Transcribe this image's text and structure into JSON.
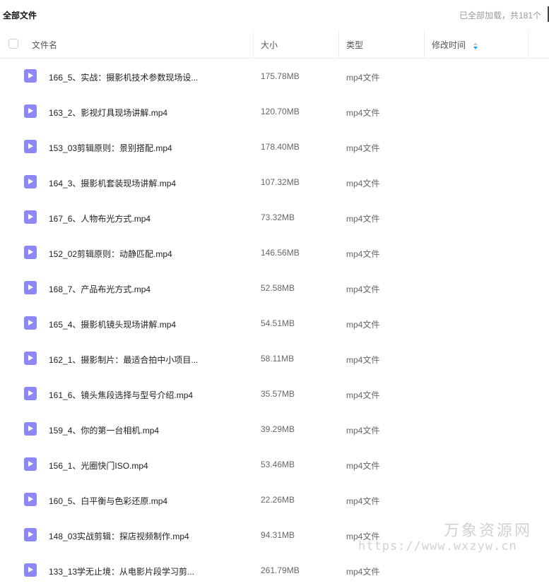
{
  "breadcrumb": "全部文件",
  "load_status": "已全部加载，共181个",
  "columns": {
    "name": "文件名",
    "size": "大小",
    "type": "类型",
    "modified": "修改时间"
  },
  "files": [
    {
      "name": "166_5、实战：摄影机技术参数现场设...",
      "size": "175.78MB",
      "type": "mp4文件"
    },
    {
      "name": "163_2、影视灯具现场讲解.mp4",
      "size": "120.70MB",
      "type": "mp4文件"
    },
    {
      "name": "153_03剪辑原则：景别搭配.mp4",
      "size": "178.40MB",
      "type": "mp4文件"
    },
    {
      "name": "164_3、摄影机套装现场讲解.mp4",
      "size": "107.32MB",
      "type": "mp4文件"
    },
    {
      "name": "167_6、人物布光方式.mp4",
      "size": "73.32MB",
      "type": "mp4文件"
    },
    {
      "name": "152_02剪辑原则：动静匹配.mp4",
      "size": "146.56MB",
      "type": "mp4文件"
    },
    {
      "name": "168_7、产品布光方式.mp4",
      "size": "52.58MB",
      "type": "mp4文件"
    },
    {
      "name": "165_4、摄影机镜头现场讲解.mp4",
      "size": "54.51MB",
      "type": "mp4文件"
    },
    {
      "name": "162_1、摄影制片：最适合拍中小项目...",
      "size": "58.11MB",
      "type": "mp4文件"
    },
    {
      "name": "161_6、镜头焦段选择与型号介绍.mp4",
      "size": "35.57MB",
      "type": "mp4文件"
    },
    {
      "name": "159_4、你的第一台相机.mp4",
      "size": "39.29MB",
      "type": "mp4文件"
    },
    {
      "name": "156_1、光圈快门ISO.mp4",
      "size": "53.46MB",
      "type": "mp4文件"
    },
    {
      "name": "160_5、白平衡与色彩还原.mp4",
      "size": "22.26MB",
      "type": "mp4文件"
    },
    {
      "name": "148_03实战剪辑：探店视频制作.mp4",
      "size": "94.31MB",
      "type": "mp4文件"
    },
    {
      "name": "133_13学无止境：从电影片段学习剪...",
      "size": "261.79MB",
      "type": "mp4文件"
    }
  ],
  "icons": {
    "file": "video-file-icon",
    "sort": "sort-icon",
    "checkbox": "checkbox"
  },
  "colors": {
    "file_icon": "#8c88f7",
    "sort_active": "#06a7ff"
  },
  "watermark": {
    "title": "万象资源网",
    "url": "https://www.wxzyw.cn"
  }
}
